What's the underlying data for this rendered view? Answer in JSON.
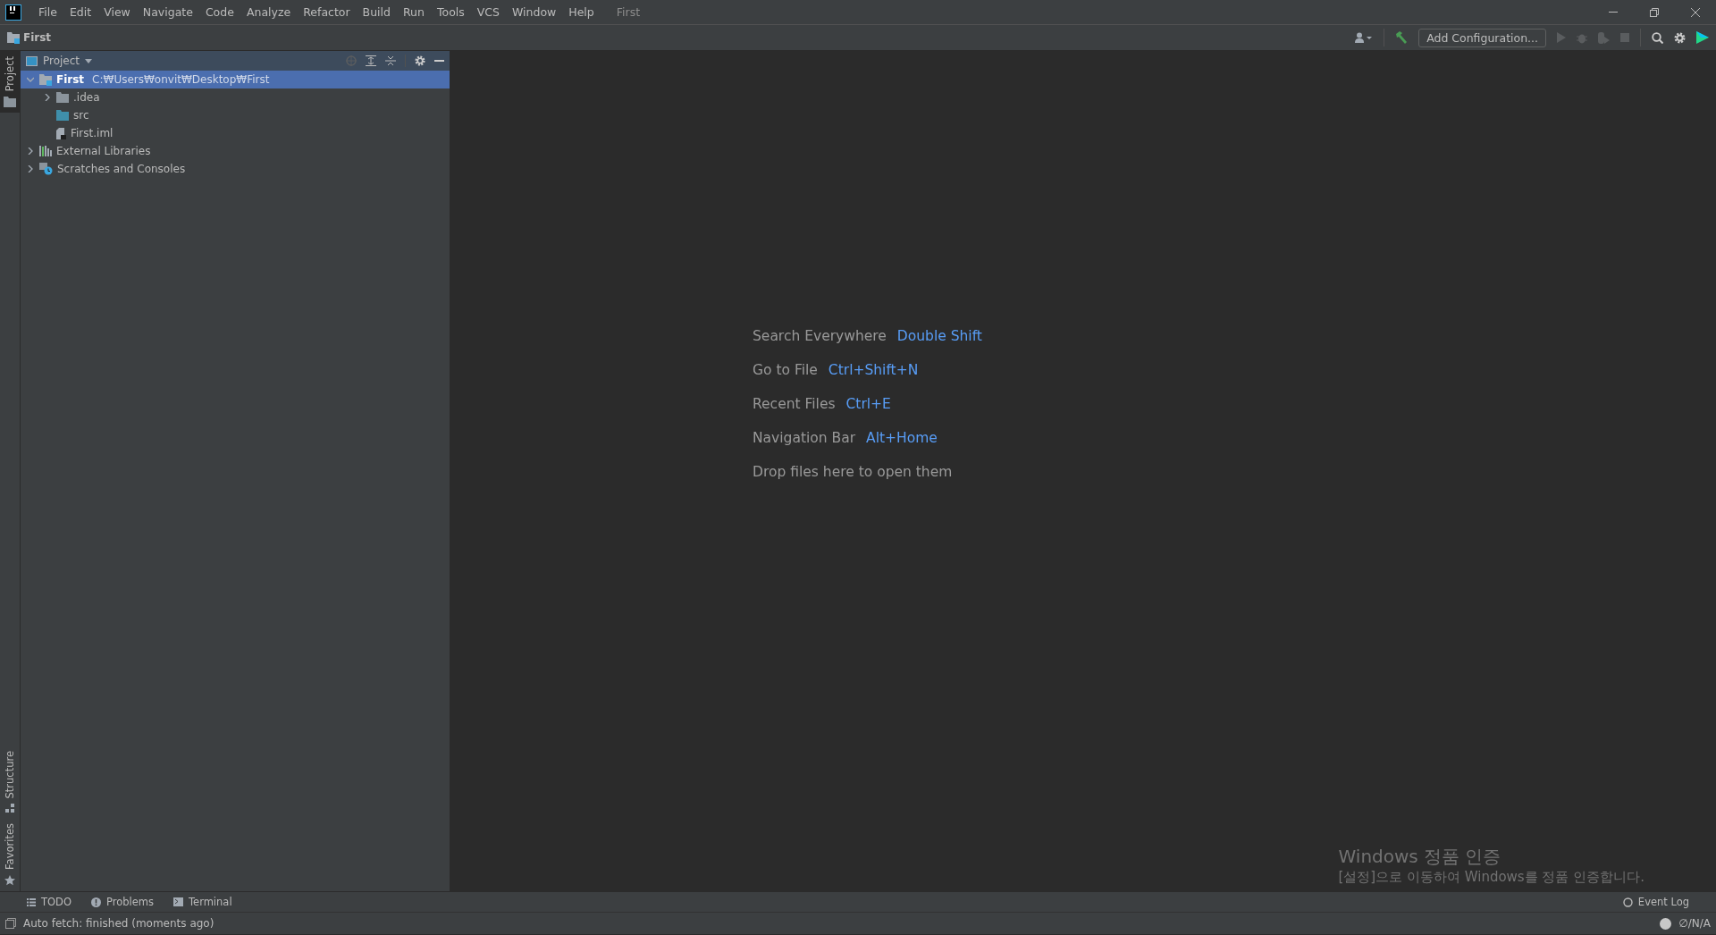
{
  "menu_bar": {
    "items": [
      "File",
      "Edit",
      "View",
      "Navigate",
      "Code",
      "Analyze",
      "Refactor",
      "Build",
      "Run",
      "Tools",
      "VCS",
      "Window",
      "Help"
    ],
    "project_title": "First"
  },
  "nav_bar": {
    "breadcrumb": "First",
    "run_config": "Add Configuration..."
  },
  "left_stripe": [
    {
      "label": "Project",
      "selected": true,
      "kind": "folder"
    },
    {
      "label": "Structure",
      "selected": false,
      "kind": "structure"
    },
    {
      "label": "Favorites",
      "selected": false,
      "kind": "star"
    }
  ],
  "project_panel": {
    "title": "Project",
    "tree": [
      {
        "label": "First",
        "path": "C:₩Users₩onvit₩Desktop₩First",
        "kind": "module",
        "expanded": true,
        "selected": true,
        "children": [
          {
            "label": ".idea",
            "kind": "folder",
            "expanded": false,
            "selected": false
          },
          {
            "label": "src",
            "kind": "source",
            "selected": false
          },
          {
            "label": "First.iml",
            "kind": "file",
            "selected": false
          }
        ]
      },
      {
        "label": "External Libraries",
        "kind": "library",
        "expanded": false,
        "selected": false
      },
      {
        "label": "Scratches and Consoles",
        "kind": "scratch",
        "expanded": false,
        "selected": false
      }
    ]
  },
  "editor_hints": [
    {
      "action": "Search Everywhere",
      "shortcut": "Double Shift"
    },
    {
      "action": "Go to File",
      "shortcut": "Ctrl+Shift+N"
    },
    {
      "action": "Recent Files",
      "shortcut": "Ctrl+E"
    },
    {
      "action": "Navigation Bar",
      "shortcut": "Alt+Home"
    },
    {
      "action": "Drop files here to open them"
    }
  ],
  "activation_notice": {
    "title": "Windows 정품 인증",
    "message": "[설정]으로 이동하여 Windows를 정품 인증합니다."
  },
  "bottom_tools": [
    {
      "label": "TODO",
      "kind": "list"
    },
    {
      "label": "Problems",
      "kind": "warning"
    },
    {
      "label": "Terminal",
      "kind": "terminal"
    }
  ],
  "event_log": "Event Log",
  "status_bar": {
    "message": "Auto fetch: finished (moments ago)",
    "vcs": "∅/N/A"
  }
}
